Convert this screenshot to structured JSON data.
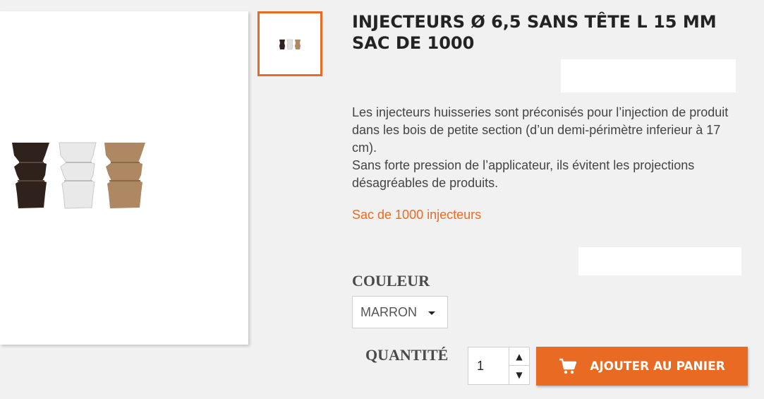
{
  "product": {
    "title": "INJECTEURS Ø 6,5 SANS TÊTE L 15 MM SAC DE 1000",
    "description": [
      "Les injecteurs huisseries sont préconisés pour l’injection de produit dans les bois de petite section (d’un demi-périmètre inferieur à 17 cm).",
      "Sans forte pression de l’applicateur, ils évitent les projections désagréables de produits."
    ],
    "subtitle": "Sac de 1000 injecteurs",
    "accent_color": "#e96b23"
  },
  "options": {
    "color_label": "COULEUR",
    "color_value": "MARRON",
    "quantity_label": "QUANTITÉ",
    "quantity_value": "1"
  },
  "actions": {
    "add_to_cart_label": "AJOUTER AU PANIER",
    "add_to_cart_icon": "cart-icon"
  }
}
